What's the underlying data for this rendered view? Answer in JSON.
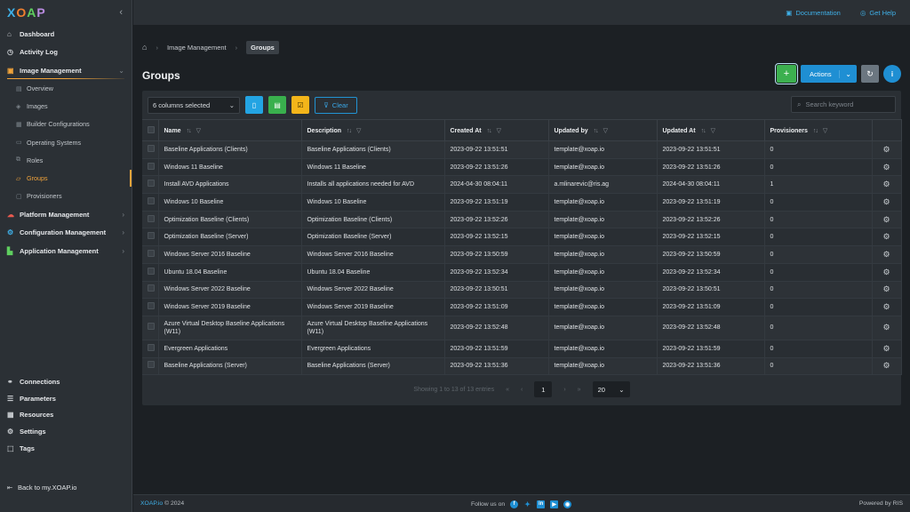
{
  "app": {
    "logo_text": "XOAP"
  },
  "sidebar": {
    "items": [
      {
        "label": "Dashboard",
        "icon": "dashboard-icon"
      },
      {
        "label": "Activity Log",
        "icon": "clock-icon"
      },
      {
        "label": "Image Management",
        "icon": "image-icon"
      }
    ],
    "image_sub": [
      {
        "label": "Overview"
      },
      {
        "label": "Images"
      },
      {
        "label": "Builder Configurations"
      },
      {
        "label": "Operating Systems"
      },
      {
        "label": "Roles"
      },
      {
        "label": "Groups"
      },
      {
        "label": "Provisioners"
      }
    ],
    "sections": [
      {
        "label": "Platform Management"
      },
      {
        "label": "Configuration Management"
      },
      {
        "label": "Application Management"
      }
    ],
    "bottom": [
      {
        "label": "Connections"
      },
      {
        "label": "Parameters"
      },
      {
        "label": "Resources"
      },
      {
        "label": "Settings"
      },
      {
        "label": "Tags"
      }
    ],
    "back_label": "Back to my.XOAP.io"
  },
  "topbar": {
    "documentation": "Documentation",
    "help": "Get Help"
  },
  "breadcrumb": {
    "level1": "Image Management",
    "current": "Groups"
  },
  "page": {
    "title": "Groups"
  },
  "toolbar": {
    "add_label": "+",
    "actions_label": "Actions",
    "columns_selected": "6 columns selected",
    "clear_label": "Clear",
    "search_placeholder": "Search keyword"
  },
  "table": {
    "columns": [
      "Name",
      "Description",
      "Created At",
      "Updated by",
      "Updated At",
      "Provisioners"
    ],
    "rows": [
      [
        "Baseline Applications (Clients)",
        "Baseline Applications (Clients)",
        "2023-09-22 13:51:51",
        "template@xoap.io",
        "2023-09-22 13:51:51",
        "0"
      ],
      [
        "Windows 11 Baseline",
        "Windows 11 Baseline",
        "2023-09-22 13:51:26",
        "template@xoap.io",
        "2023-09-22 13:51:26",
        "0"
      ],
      [
        "Install AVD Applications",
        "Installs all applications needed for AVD",
        "2024-04-30 08:04:11",
        "a.mlinarevic@ris.ag",
        "2024-04-30 08:04:11",
        "1"
      ],
      [
        "Windows 10 Baseline",
        "Windows 10 Baseline",
        "2023-09-22 13:51:19",
        "template@xoap.io",
        "2023-09-22 13:51:19",
        "0"
      ],
      [
        "Optimization Baseline (Clients)",
        "Optimization Baseline (Clients)",
        "2023-09-22 13:52:26",
        "template@xoap.io",
        "2023-09-22 13:52:26",
        "0"
      ],
      [
        "Optimization Baseline (Server)",
        "Optimization Baseline (Server)",
        "2023-09-22 13:52:15",
        "template@xoap.io",
        "2023-09-22 13:52:15",
        "0"
      ],
      [
        "Windows Server 2016 Baseline",
        "Windows Server 2016 Baseline",
        "2023-09-22 13:50:59",
        "template@xoap.io",
        "2023-09-22 13:50:59",
        "0"
      ],
      [
        "Ubuntu 18.04 Baseline",
        "Ubuntu 18.04 Baseline",
        "2023-09-22 13:52:34",
        "template@xoap.io",
        "2023-09-22 13:52:34",
        "0"
      ],
      [
        "Windows Server 2022 Baseline",
        "Windows Server 2022 Baseline",
        "2023-09-22 13:50:51",
        "template@xoap.io",
        "2023-09-22 13:50:51",
        "0"
      ],
      [
        "Windows Server 2019 Baseline",
        "Windows Server 2019 Baseline",
        "2023-09-22 13:51:09",
        "template@xoap.io",
        "2023-09-22 13:51:09",
        "0"
      ],
      [
        "Azure Virtual Desktop Baseline Applications (W11)",
        "Azure Virtual Desktop Baseline Applications (W11)",
        "2023-09-22 13:52:48",
        "template@xoap.io",
        "2023-09-22 13:52:48",
        "0"
      ],
      [
        "Evergreen Applications",
        "Evergreen Applications",
        "2023-09-22 13:51:59",
        "template@xoap.io",
        "2023-09-22 13:51:59",
        "0"
      ],
      [
        "Baseline Applications (Server)",
        "Baseline Applications (Server)",
        "2023-09-22 13:51:36",
        "template@xoap.io",
        "2023-09-22 13:51:36",
        "0"
      ]
    ]
  },
  "pagination": {
    "summary": "Showing 1 to 13 of 13 entries",
    "current_page": "1",
    "page_size": "20"
  },
  "footer": {
    "brand": "XOAP.io",
    "copyright": "© 2024",
    "follow": "Follow us on",
    "powered": "Powered by RIS"
  },
  "colors": {
    "accent": "#f2a43a",
    "primary": "#1f8fd3",
    "success": "#3cb04f"
  }
}
